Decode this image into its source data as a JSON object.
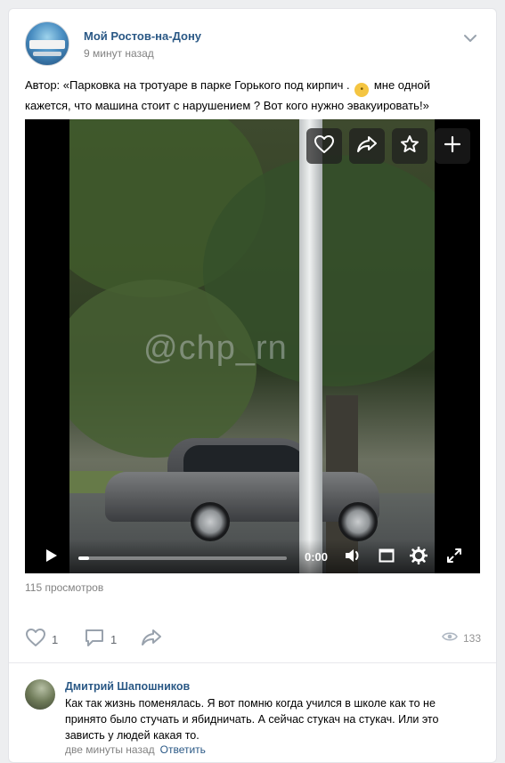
{
  "post": {
    "group_name": "Мой Ростов-на-Дону",
    "time": "9 минут назад",
    "text_before_emoji": "Автор: «Парковка на тротуаре в парке Горького под кирпич . ",
    "emoji": "face-with-raised-eyebrow",
    "text_after_emoji": " мне одной кажется, что машина стоит с нарушением ? Вот кого нужно эвакуировать!»"
  },
  "video": {
    "watermark": "@chp_rn",
    "current_time": "0:00",
    "progress_fraction": 0.05,
    "overlay_buttons": [
      "heart-icon",
      "share-arrow-icon",
      "star-icon",
      "plus-icon"
    ],
    "controls": [
      "play-icon",
      "volume-icon",
      "miniplayer-icon",
      "settings-gear-icon",
      "fullscreen-icon"
    ]
  },
  "stats": {
    "views_text": "115 просмотров",
    "likes": "1",
    "comments": "1",
    "views": "133"
  },
  "comment": {
    "author": "Дмитрий Шапошников",
    "text": "Как так жизнь поменялась. Я вот помню когда учился в школе как то не принято было стучать и ябидничать. А сейчас стукач на стукач. Или это зависть у людей какая то.",
    "time": "две минуты назад",
    "reply_label": "Ответить"
  },
  "colors": {
    "link_blue": "#2a5885",
    "meta_gray": "#828282",
    "background": "#edeef0"
  }
}
